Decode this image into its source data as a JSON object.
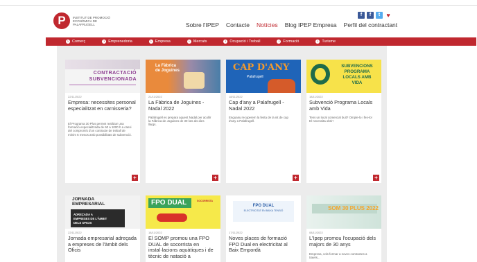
{
  "header": {
    "logo_letter": "P",
    "logo_text": "Institut de Promoció Econòmica de Palafrugell",
    "nav": [
      {
        "label": "Sobre l'IPEP",
        "active": false
      },
      {
        "label": "Contacte",
        "active": false
      },
      {
        "label": "Notícies",
        "active": true
      },
      {
        "label": "Blog IPEP Empresa",
        "active": false
      },
      {
        "label": "Perfil del contractant",
        "active": false
      }
    ],
    "social": [
      {
        "icon": "facebook-icon",
        "glyph": "f",
        "color": "#3b5998"
      },
      {
        "icon": "flickr-icon",
        "glyph": "f",
        "color": "#c0282f"
      },
      {
        "icon": "twitter-icon",
        "glyph": "t",
        "color": "#55acee"
      },
      {
        "icon": "youtube-icon",
        "glyph": "▶",
        "color": "#c0282f"
      }
    ]
  },
  "categories": [
    {
      "label": "Comerç"
    },
    {
      "label": "Emprenedoria"
    },
    {
      "label": "Empresa"
    },
    {
      "label": "Mercats"
    },
    {
      "label": "Ocupació i Treball"
    },
    {
      "label": "Formació"
    },
    {
      "label": "Turisme"
    }
  ],
  "cards": [
    {
      "thumb_lines": [
        "CONTRACTACIÓ",
        "SUBVENCIONADA"
      ],
      "date": "22/11/2022",
      "title": "Empresa: necessites personal especialitzat en carnisseria?",
      "excerpt": "El Programa 30 Plus permet realitzar una formació especialitzada de 60 a 1000 h a canvi del compromís d'un contracte de treball de mínim 6 mesos amb possibilitats de subvenció."
    },
    {
      "thumb_lines": [
        "La Fàbrica",
        "de Joguines"
      ],
      "date": "21/11/2022",
      "title": "La Fàbrica de Joguines - Nadal 2022",
      "excerpt": "Palafrugell es prepara aquest Nadal per acollir la Fàbrica de Joguines de 30 lots als dies llargs."
    },
    {
      "thumb_lines": [
        "CAP D'ANY",
        "Palafrugell"
      ],
      "date": "18/11/2022",
      "title": "Cap d'any a Palafrugell - Nadal 2022",
      "excerpt": "Enguany recuperem la festa de la nit de cap d'any a Palafrugell."
    },
    {
      "thumb_lines": [
        "SUBVENCIONS",
        "PROGRAMA",
        "LOCALS AMB",
        "VIDA"
      ],
      "date": "18/11/2022",
      "title": "Subvenció Programa Locals amb Vida",
      "excerpt": "Tens un local comercial buit? Omple-lo i fes-lo! El necessita obrir!"
    },
    {
      "thumb_lines": [
        "JORNADA",
        "EMPRESARIAL",
        "ADREÇADA A",
        "EMPRESES DE L'ÀMBIT",
        "DELS OFICIS"
      ],
      "date": "22/11/2022",
      "title": "Jornada empresarial adreçada a empreses de l'àmbit dels Oficis",
      "excerpt": ""
    },
    {
      "thumb_lines": [
        "FPO DUAL",
        "SOCORRISTA"
      ],
      "date": "18/11/2022",
      "title": "El SOMP promou una FPO DUAL de socorrista en instal·lacions aquàtiques i de tècnic de natació a",
      "excerpt": ""
    },
    {
      "thumb_lines": [
        "FPO DUAL",
        "ELECTRICITAT EN BAIXA TENSIÓ"
      ],
      "date": "17/11/2022",
      "title": "Noves places de formació FPO Dual en electricitat al Baix Empordà",
      "excerpt": ""
    },
    {
      "thumb_lines": [
        "SOM 30 PLUS 2022"
      ],
      "date": "08/11/2022",
      "title": "L'Ipep promou l'ocupació dels majors de 30 anys",
      "excerpt": "Empresa, vols formar a noves contractes a través..."
    }
  ]
}
